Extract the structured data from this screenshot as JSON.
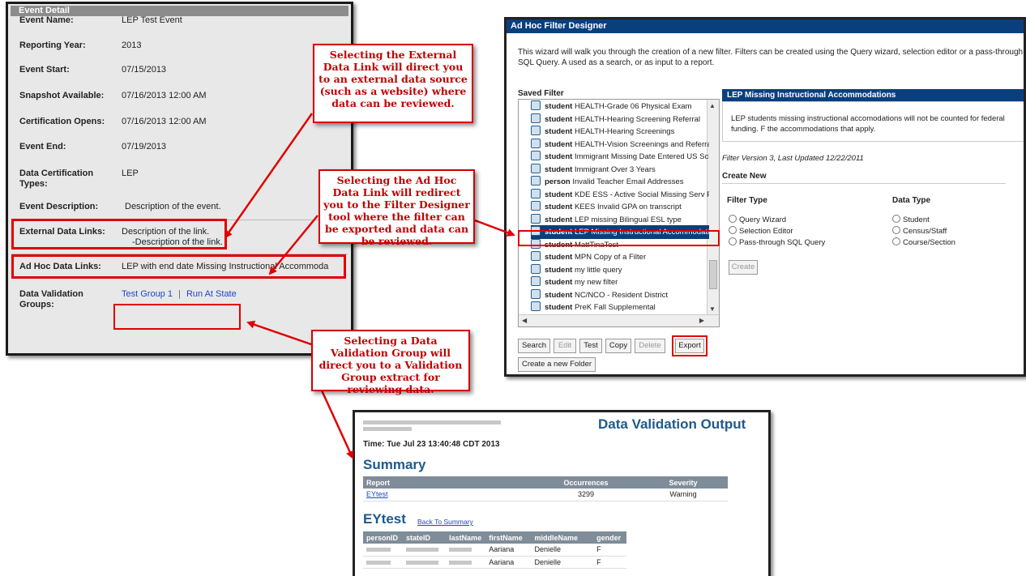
{
  "event_detail": {
    "header": "Event Detail",
    "rows": [
      {
        "label": "Event Name:",
        "value": "LEP Test Event"
      },
      {
        "label": "Reporting Year:",
        "value": "2013"
      },
      {
        "label": "Event Start:",
        "value": "07/15/2013"
      },
      {
        "label": "Snapshot Available:",
        "value": "07/16/2013 12:00 AM"
      },
      {
        "label": "Certification Opens:",
        "value": "07/16/2013 12:00 AM"
      },
      {
        "label": "Event End:",
        "value": "07/19/2013"
      },
      {
        "label": "Data Certification",
        "label2": "Types:",
        "value": "LEP"
      },
      {
        "label": "Event Description:",
        "value": "Description of the event."
      }
    ],
    "external_links_label": "External Data Links:",
    "external_link": "Description of the link.",
    "external_link_desc": "-Description of the link.",
    "adhoc_label": "Ad Hoc Data Links:",
    "adhoc_link": "LEP with end date Missing Instructional Accommoda",
    "dvg_label": "Data Validation",
    "dvg_label2": "Groups:",
    "dvg_link1": "Test Group 1",
    "dvg_sep": "|",
    "dvg_link2": "Run At State"
  },
  "callouts": {
    "external": "Selecting the External Data Link will direct you to an external data source (such as a website) where data can be reviewed.",
    "adhoc": "Selecting the Ad Hoc Data Link will redirect you to the Filter Designer tool where the filter can be exported and data can be reviewed.",
    "dvg": "Selecting a Data Validation Group will direct you to a Validation Group extract for reviewing data."
  },
  "adhoc_panel": {
    "title": "Ad Hoc Filter Designer",
    "intro": "This wizard will walk you through the creation of a new filter. Filters can be created using the Query wizard, selection editor or a pass-through SQL Query. A used as a search, or as input to a report.",
    "saved_filter_label": "Saved Filter",
    "items": [
      {
        "type": "student",
        "name": "HEALTH-Grade 06 Physical Exam"
      },
      {
        "type": "student",
        "name": "HEALTH-Hearing Screening Referral"
      },
      {
        "type": "student",
        "name": "HEALTH-Hearing Screenings"
      },
      {
        "type": "student",
        "name": "HEALTH-Vision Screenings and Referra"
      },
      {
        "type": "student",
        "name": "Immigrant Missing Date Entered US Scho"
      },
      {
        "type": "student",
        "name": "Immigrant Over 3 Years"
      },
      {
        "type": "person",
        "name": "Invalid Teacher Email Addresses"
      },
      {
        "type": "student",
        "name": "KDE ESS - Active Social Missing Serv P"
      },
      {
        "type": "student",
        "name": "KEES Invalid GPA on transcript"
      },
      {
        "type": "student",
        "name": "LEP missing Bilingual ESL type"
      },
      {
        "type": "student",
        "name": "LEP Missing Instructional Accommodatio"
      },
      {
        "type": "student",
        "name": "MattTinaTest"
      },
      {
        "type": "student",
        "name": "MPN Copy of a Filter"
      },
      {
        "type": "student",
        "name": "my little query"
      },
      {
        "type": "student",
        "name": "my new filter"
      },
      {
        "type": "student",
        "name": "NC/NCO - Resident District"
      },
      {
        "type": "student",
        "name": "PreK Fall Supplemental"
      }
    ],
    "buttons": {
      "search": "Search",
      "edit": "Edit",
      "test": "Test",
      "copy": "Copy",
      "delete": "Delete",
      "export": "Export",
      "new_folder": "Create a new Folder"
    },
    "detail_title": "LEP Missing Instructional Accommodations",
    "detail_desc": "LEP students missing instructional accomodations will not be counted for federal funding. F the accommodations that apply.",
    "filter_version": "Filter Version 3,   Last Updated 12/22/2011",
    "create_new": "Create New",
    "filter_type_label": "Filter Type",
    "data_type_label": "Data Type",
    "filter_types": [
      "Query Wizard",
      "Selection Editor",
      "Pass-through SQL Query"
    ],
    "data_types": [
      "Student",
      "Census/Staff",
      "Course/Section"
    ],
    "create_button": "Create"
  },
  "dvo_panel": {
    "title": "Data Validation Output",
    "time": "Time: Tue Jul 23 13:40:48 CDT 2013",
    "summary": "Summary",
    "summary_cols": [
      "Report",
      "Occurrences",
      "Severity"
    ],
    "summary_row": {
      "report": "EYtest",
      "occurrences": "3299",
      "severity": "Warning"
    },
    "section": "EYtest",
    "back_link": "Back To Summary",
    "detail_cols": [
      "personID",
      "stateID",
      "lastName",
      "firstName",
      "middleName",
      "gender"
    ],
    "detail_rows": [
      {
        "firstName": "Aariana",
        "middleName": "Denielle",
        "gender": "F"
      },
      {
        "firstName": "Aariana",
        "middleName": "Denielle",
        "gender": "F"
      }
    ]
  },
  "colors": {
    "accent_red": "#e00000",
    "header_blue": "#0a3f7e",
    "link_blue": "#2344c8"
  }
}
